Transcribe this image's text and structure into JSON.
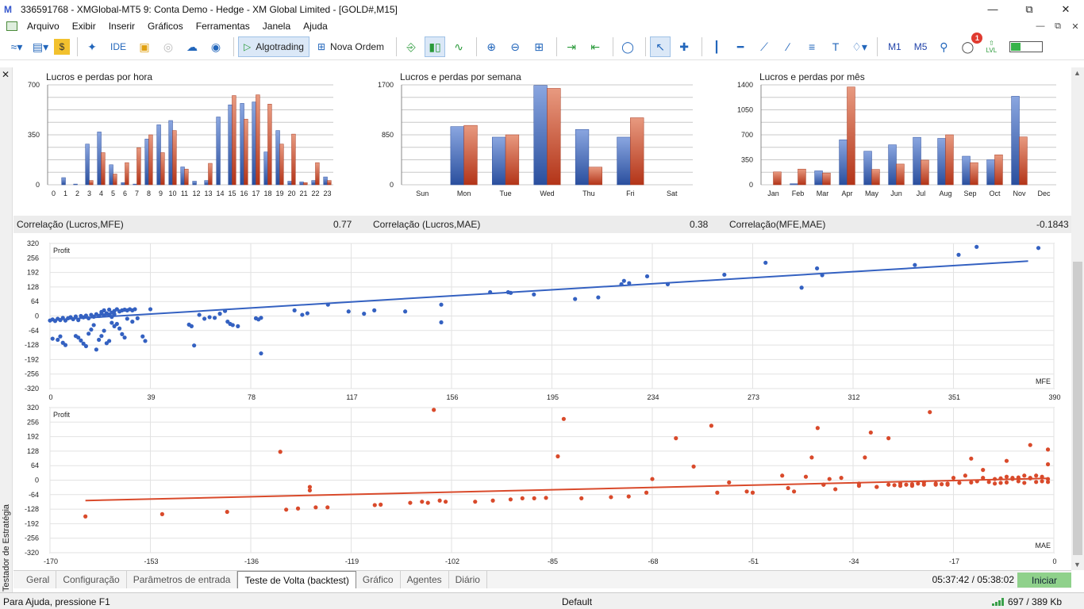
{
  "window": {
    "title": "336591768 - XMGlobal-MT5 9: Conta Demo - Hedge - XM Global Limited - [GOLD#,M15]",
    "logo": "M"
  },
  "menu": [
    "Arquivo",
    "Exibir",
    "Inserir",
    "Gráficos",
    "Ferramentas",
    "Janela",
    "Ajuda"
  ],
  "toolbar": {
    "ide_label": "IDE",
    "algotrading_label": "Algotrading",
    "new_order_label": "Nova Ordem",
    "timeframes": [
      "M1",
      "M5"
    ],
    "notifications_count": "1",
    "lvl_label": "LVL"
  },
  "left_panel": {
    "label": "Testador de Estratégia"
  },
  "colors": {
    "blue": "#3461c1",
    "red": "#d94a2b",
    "start_green": "#8fd18b"
  },
  "charts": {
    "hourly": {
      "title": "Lucros e perdas por hora",
      "y_ticks": [
        "0",
        "350",
        "700"
      ],
      "ylim": [
        0,
        700
      ],
      "categories": [
        "0",
        "1",
        "2",
        "3",
        "4",
        "5",
        "6",
        "7",
        "8",
        "9",
        "10",
        "11",
        "12",
        "13",
        "14",
        "15",
        "16",
        "17",
        "18",
        "19",
        "20",
        "21",
        "22",
        "23"
      ],
      "profit": [
        0,
        50,
        5,
        285,
        370,
        140,
        15,
        5,
        320,
        420,
        450,
        125,
        25,
        30,
        475,
        560,
        570,
        580,
        230,
        380,
        25,
        20,
        30,
        55
      ],
      "loss": [
        0,
        0,
        0,
        30,
        225,
        75,
        155,
        260,
        350,
        225,
        380,
        110,
        0,
        150,
        0,
        625,
        460,
        630,
        565,
        285,
        355,
        15,
        155,
        30
      ]
    },
    "weekly": {
      "title": "Lucros e perdas por semana",
      "y_ticks": [
        "0",
        "850",
        "1700"
      ],
      "ylim": [
        0,
        1700
      ],
      "categories": [
        "Sun",
        "Mon",
        "Tue",
        "Wed",
        "Thu",
        "Fri",
        "Sat"
      ],
      "profit": [
        0,
        990,
        810,
        1690,
        940,
        810,
        0
      ],
      "loss": [
        0,
        1010,
        850,
        1640,
        300,
        1140,
        0
      ]
    },
    "monthly": {
      "title": "Lucros e perdas por mês",
      "y_ticks": [
        "0",
        "350",
        "700",
        "1050",
        "1400"
      ],
      "ylim": [
        0,
        1400
      ],
      "categories": [
        "Jan",
        "Feb",
        "Mar",
        "Apr",
        "May",
        "Jun",
        "Jul",
        "Aug",
        "Sep",
        "Oct",
        "Nov",
        "Dec"
      ],
      "profit": [
        0,
        15,
        195,
        630,
        470,
        560,
        665,
        650,
        400,
        350,
        1240,
        0
      ],
      "loss": [
        180,
        220,
        165,
        1370,
        215,
        290,
        345,
        700,
        310,
        420,
        670,
        0
      ]
    }
  },
  "correlations": [
    {
      "label": "Correlação (Lucros,MFE)",
      "value": "0.77"
    },
    {
      "label": "Correlação (Lucros,MAE)",
      "value": "0.38"
    },
    {
      "label": "Correlação(MFE,MAE)",
      "value": "-0.1843"
    }
  ],
  "chart_data": [
    {
      "type": "scatter",
      "ylabel": "Profit",
      "xlabel": "MFE",
      "xlim": [
        0,
        390
      ],
      "ylim": [
        -320,
        320
      ],
      "x_ticks": [
        0,
        39,
        78,
        117,
        156,
        195,
        234,
        273,
        312,
        351,
        390
      ],
      "y_ticks": [
        -320,
        -256,
        -192,
        -128,
        -64,
        0,
        64,
        128,
        192,
        256,
        320
      ],
      "trendline": [
        [
          0,
          -18
        ],
        [
          380,
          242
        ]
      ],
      "points": [
        [
          0,
          -20
        ],
        [
          1,
          -15
        ],
        [
          2,
          -22
        ],
        [
          3,
          -12
        ],
        [
          4,
          -18
        ],
        [
          5,
          -8
        ],
        [
          6,
          -20
        ],
        [
          7,
          -10
        ],
        [
          8,
          -5
        ],
        [
          9,
          -14
        ],
        [
          10,
          -2
        ],
        [
          11,
          -18
        ],
        [
          12,
          0
        ],
        [
          13,
          -6
        ],
        [
          14,
          2
        ],
        [
          15,
          -10
        ],
        [
          16,
          5
        ],
        [
          17,
          -3
        ],
        [
          18,
          8
        ],
        [
          19,
          0
        ],
        [
          20,
          10
        ],
        [
          21,
          3
        ],
        [
          22,
          12
        ],
        [
          23,
          6
        ],
        [
          24,
          -4
        ],
        [
          25,
          8
        ],
        [
          1,
          -100
        ],
        [
          3,
          -105
        ],
        [
          4,
          -90
        ],
        [
          5,
          -118
        ],
        [
          6,
          -128
        ],
        [
          10,
          -88
        ],
        [
          11,
          -95
        ],
        [
          12,
          -108
        ],
        [
          13,
          -122
        ],
        [
          14,
          -133
        ],
        [
          15,
          -78
        ],
        [
          16,
          -60
        ],
        [
          17,
          -40
        ],
        [
          18,
          -148
        ],
        [
          19,
          -105
        ],
        [
          20,
          -88
        ],
        [
          21,
          -65
        ],
        [
          22,
          -120
        ],
        [
          23,
          -110
        ],
        [
          24,
          -30
        ],
        [
          25,
          -45
        ],
        [
          26,
          -35
        ],
        [
          27,
          -55
        ],
        [
          28,
          -80
        ],
        [
          29,
          -95
        ],
        [
          20,
          18
        ],
        [
          21,
          25
        ],
        [
          22,
          10
        ],
        [
          23,
          28
        ],
        [
          24,
          15
        ],
        [
          25,
          22
        ],
        [
          26,
          30
        ],
        [
          27,
          20
        ],
        [
          28,
          25
        ],
        [
          29,
          28
        ],
        [
          30,
          25
        ],
        [
          31,
          30
        ],
        [
          32,
          25
        ],
        [
          33,
          30
        ],
        [
          30,
          -12
        ],
        [
          32,
          -25
        ],
        [
          34,
          -10
        ],
        [
          36,
          -90
        ],
        [
          37,
          -110
        ],
        [
          39,
          30
        ],
        [
          54,
          -38
        ],
        [
          55,
          -45
        ],
        [
          56,
          -130
        ],
        [
          58,
          5
        ],
        [
          60,
          -12
        ],
        [
          62,
          -5
        ],
        [
          64,
          -8
        ],
        [
          66,
          10
        ],
        [
          68,
          22
        ],
        [
          69,
          -25
        ],
        [
          70,
          -35
        ],
        [
          71,
          -40
        ],
        [
          73,
          -45
        ],
        [
          80,
          -10
        ],
        [
          81,
          -15
        ],
        [
          82,
          -8
        ],
        [
          82,
          -165
        ],
        [
          95,
          25
        ],
        [
          98,
          5
        ],
        [
          100,
          12
        ],
        [
          108,
          50
        ],
        [
          116,
          20
        ],
        [
          122,
          10
        ],
        [
          126,
          25
        ],
        [
          138,
          20
        ],
        [
          152,
          50
        ],
        [
          152,
          -28
        ],
        [
          171,
          105
        ],
        [
          178,
          105
        ],
        [
          179,
          102
        ],
        [
          188,
          95
        ],
        [
          204,
          75
        ],
        [
          213,
          82
        ],
        [
          222,
          140
        ],
        [
          223,
          155
        ],
        [
          225,
          145
        ],
        [
          232,
          175
        ],
        [
          240,
          140
        ],
        [
          262,
          182
        ],
        [
          278,
          235
        ],
        [
          292,
          125
        ],
        [
          298,
          210
        ],
        [
          300,
          180
        ],
        [
          336,
          225
        ],
        [
          353,
          270
        ],
        [
          360,
          305
        ],
        [
          384,
          300
        ]
      ]
    },
    {
      "type": "scatter",
      "ylabel": "Profit",
      "xlabel": "MAE",
      "xlim": [
        -170,
        0
      ],
      "ylim": [
        -320,
        320
      ],
      "x_ticks": [
        -170,
        -153,
        -136,
        -119,
        -102,
        -85,
        -68,
        -51,
        -34,
        -17,
        0
      ],
      "y_ticks": [
        -320,
        -256,
        -192,
        -128,
        -64,
        0,
        64,
        128,
        192,
        256,
        320
      ],
      "trendline": [
        [
          -164,
          -90
        ],
        [
          -1,
          8
        ]
      ],
      "points": [
        [
          -164,
          -160
        ],
        [
          -151,
          -150
        ],
        [
          -140,
          -140
        ],
        [
          -131,
          125
        ],
        [
          -130,
          -130
        ],
        [
          -128,
          -125
        ],
        [
          -126,
          -45
        ],
        [
          -126,
          -30
        ],
        [
          -125,
          -120
        ],
        [
          -123,
          -120
        ],
        [
          -115,
          -110
        ],
        [
          -114,
          -108
        ],
        [
          -109,
          -100
        ],
        [
          -107,
          -95
        ],
        [
          -106,
          -100
        ],
        [
          -104,
          -90
        ],
        [
          -103,
          -95
        ],
        [
          -105,
          310
        ],
        [
          -98,
          -95
        ],
        [
          -95,
          -90
        ],
        [
          -92,
          -85
        ],
        [
          -90,
          -80
        ],
        [
          -88,
          -80
        ],
        [
          -86,
          -78
        ],
        [
          -84,
          105
        ],
        [
          -83,
          270
        ],
        [
          -80,
          -80
        ],
        [
          -75,
          -75
        ],
        [
          -72,
          -72
        ],
        [
          -69,
          -55
        ],
        [
          -68,
          5
        ],
        [
          -64,
          185
        ],
        [
          -61,
          60
        ],
        [
          -58,
          240
        ],
        [
          -57,
          -55
        ],
        [
          -55,
          -10
        ],
        [
          -52,
          -50
        ],
        [
          -51,
          -55
        ],
        [
          -46,
          20
        ],
        [
          -45,
          -35
        ],
        [
          -44,
          -50
        ],
        [
          -41,
          100
        ],
        [
          -40,
          230
        ],
        [
          -39,
          -20
        ],
        [
          -39,
          -20
        ],
        [
          -37,
          -40
        ],
        [
          -33,
          -25
        ],
        [
          -32,
          100
        ],
        [
          -31,
          210
        ],
        [
          -30,
          -30
        ],
        [
          -28,
          185
        ],
        [
          -27,
          -22
        ],
        [
          -26,
          -15
        ],
        [
          -25,
          -20
        ],
        [
          -24,
          -18
        ],
        [
          -23,
          -15
        ],
        [
          -22,
          -10
        ],
        [
          -21,
          300
        ],
        [
          -20,
          -20
        ],
        [
          -19,
          -18
        ],
        [
          -18,
          -15
        ],
        [
          -17,
          10
        ],
        [
          -16,
          -12
        ],
        [
          -15,
          20
        ],
        [
          -14,
          -10
        ],
        [
          -13,
          -5
        ],
        [
          -12,
          10
        ],
        [
          -11,
          -8
        ],
        [
          -10,
          5
        ],
        [
          -9,
          -12
        ],
        [
          -8,
          15
        ],
        [
          -7,
          10
        ],
        [
          -6,
          -5
        ],
        [
          -5,
          20
        ],
        [
          -4,
          10
        ],
        [
          -3,
          -8
        ],
        [
          -2,
          15
        ],
        [
          -1,
          5
        ],
        [
          -1,
          135
        ],
        [
          -1,
          70
        ],
        [
          -1,
          -8
        ],
        [
          -2,
          -5
        ],
        [
          -3,
          20
        ],
        [
          -4,
          8
        ],
        [
          -5,
          -12
        ],
        [
          -6,
          12
        ],
        [
          -7,
          5
        ],
        [
          -8,
          -10
        ],
        [
          -9,
          8
        ],
        [
          -10,
          -15
        ],
        [
          -12,
          45
        ],
        [
          -14,
          95
        ],
        [
          -8,
          85
        ],
        [
          -4,
          155
        ],
        [
          -18,
          -20
        ],
        [
          -20,
          -15
        ],
        [
          -22,
          -20
        ],
        [
          -24,
          -25
        ],
        [
          -26,
          -25
        ],
        [
          -28,
          -20
        ],
        [
          -30,
          -30
        ],
        [
          -33,
          -15
        ],
        [
          -36,
          10
        ],
        [
          -38,
          5
        ],
        [
          -42,
          15
        ]
      ]
    }
  ],
  "tabs": [
    {
      "label": "Geral",
      "active": false
    },
    {
      "label": "Configuração",
      "active": false
    },
    {
      "label": "Parâmetros de entrada",
      "active": false
    },
    {
      "label": "Teste de Volta (backtest)",
      "active": true
    },
    {
      "label": "Gráfico",
      "active": false
    },
    {
      "label": "Agentes",
      "active": false
    },
    {
      "label": "Diário",
      "active": false
    }
  ],
  "time_readout": "05:37:42 / 05:38:02",
  "start_label": "Iniciar",
  "status": {
    "help": "Para Ajuda, pressione F1",
    "profile": "Default",
    "traffic": "697 / 389 Kb"
  }
}
